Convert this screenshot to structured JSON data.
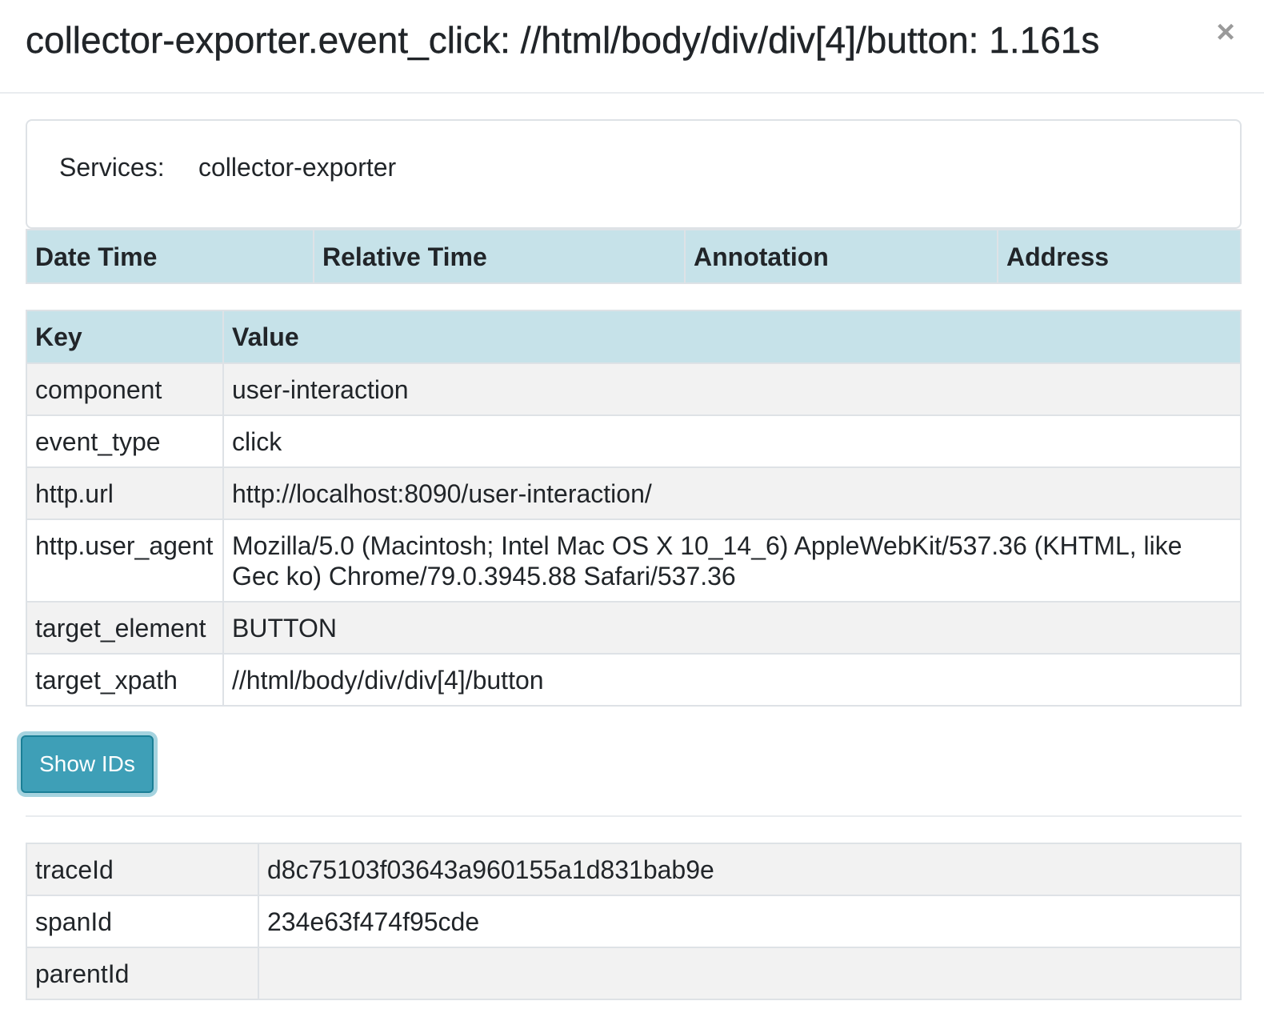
{
  "modal": {
    "title": "collector-exporter.event_click: //html/body/div/div[4]/button: 1.161s",
    "close_symbol": "×"
  },
  "services": {
    "label": "Services:",
    "value": "collector-exporter"
  },
  "annotations": {
    "headers": [
      "Date Time",
      "Relative Time",
      "Annotation",
      "Address"
    ]
  },
  "tags": {
    "headers": [
      "Key",
      "Value"
    ],
    "rows": [
      {
        "key": "component",
        "value": "user-interaction"
      },
      {
        "key": "event_type",
        "value": "click"
      },
      {
        "key": "http.url",
        "value": "http://localhost:8090/user-interaction/"
      },
      {
        "key": "http.user_agent",
        "value": "Mozilla/5.0 (Macintosh; Intel Mac OS X 10_14_6) AppleWebKit/537.36 (KHTML, like Gec ko) Chrome/79.0.3945.88 Safari/537.36"
      },
      {
        "key": "target_element",
        "value": "BUTTON"
      },
      {
        "key": "target_xpath",
        "value": "//html/body/div/div[4]/button"
      }
    ]
  },
  "ids_button": {
    "label": "Show IDs"
  },
  "ids": {
    "rows": [
      {
        "key": "traceId",
        "value": "d8c75103f03643a960155a1d831bab9e"
      },
      {
        "key": "spanId",
        "value": "234e63f474f95cde"
      },
      {
        "key": "parentId",
        "value": ""
      }
    ]
  }
}
